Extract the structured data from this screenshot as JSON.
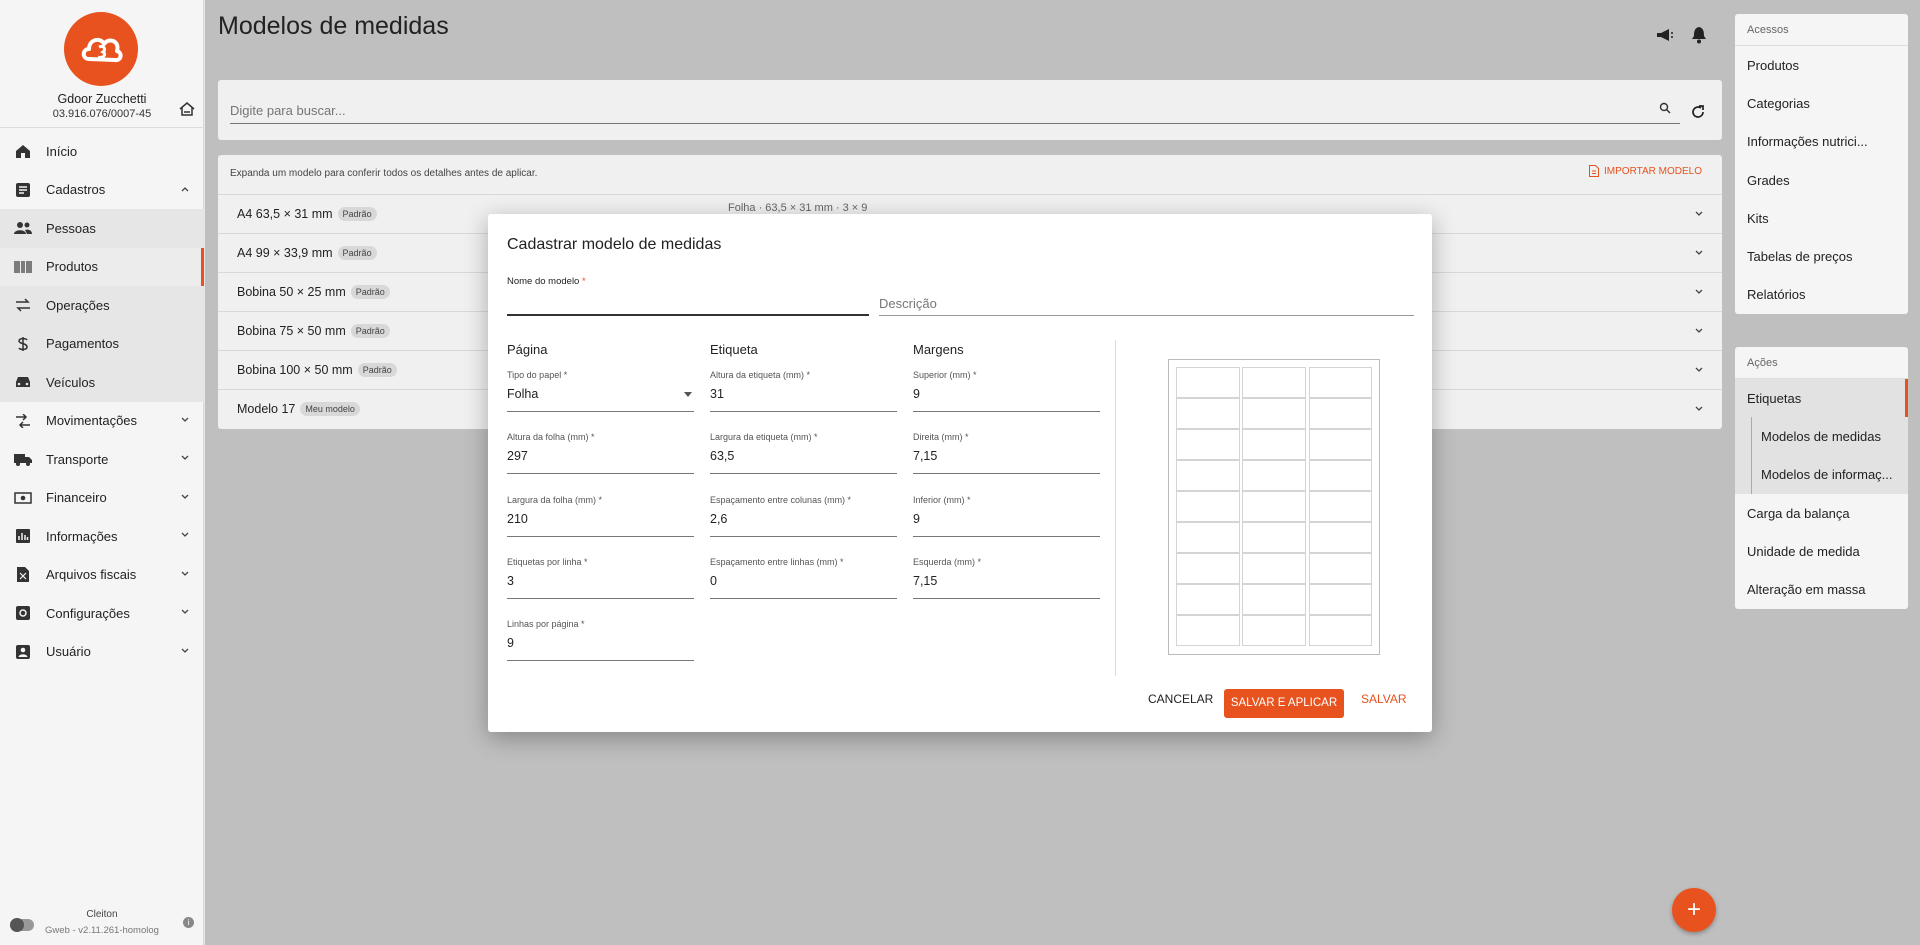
{
  "sidebar": {
    "company_name": "Gdoor Zucchetti",
    "company_cnpj": "03.916.076/0007-45",
    "items": [
      {
        "label": "Início",
        "icon": "home-icon"
      },
      {
        "label": "Cadastros",
        "icon": "list-icon",
        "expanded": true
      },
      {
        "label": "Pessoas",
        "icon": "people-icon"
      },
      {
        "label": "Produtos",
        "icon": "barcode-icon",
        "active": true
      },
      {
        "label": "Operações",
        "icon": "swap-icon"
      },
      {
        "label": "Pagamentos",
        "icon": "dollar-icon"
      },
      {
        "label": "Veículos",
        "icon": "car-icon"
      },
      {
        "label": "Movimentações",
        "icon": "arrows-icon"
      },
      {
        "label": "Transporte",
        "icon": "truck-icon"
      },
      {
        "label": "Financeiro",
        "icon": "money-icon"
      },
      {
        "label": "Informações",
        "icon": "chart-icon"
      },
      {
        "label": "Arquivos fiscais",
        "icon": "file-icon"
      },
      {
        "label": "Configurações",
        "icon": "settings-icon"
      },
      {
        "label": "Usuário",
        "icon": "user-icon"
      }
    ],
    "footer_user": "Cleiton",
    "footer_version": "Gweb - v2.11.261-homolog"
  },
  "page": {
    "title": "Modelos de medidas",
    "search_placeholder": "Digite para buscar...",
    "list_hint": "Expanda um modelo para conferir todos os detalhes antes de aplicar.",
    "import_label": "Importar modelo",
    "rows": [
      {
        "name": "A4 63,5 × 31 mm",
        "badge": "Padrão",
        "detail": "Folha · 63,5 × 31 mm · 3 × 9"
      },
      {
        "name": "A4 99 × 33,9 mm",
        "badge": "Padrão"
      },
      {
        "name": "Bobina 50 × 25 mm",
        "badge": "Padrão"
      },
      {
        "name": "Bobina 75 × 50 mm",
        "badge": "Padrão"
      },
      {
        "name": "Bobina 100 × 50 mm",
        "badge": "Padrão"
      },
      {
        "name": "Modelo 17",
        "badge": "Meu modelo"
      }
    ]
  },
  "right_panel": {
    "acessos_title": "Acessos",
    "acessos": [
      "Produtos",
      "Categorias",
      "Informações nutrici...",
      "Grades",
      "Kits",
      "Tabelas de preços",
      "Relatórios"
    ],
    "acoes_title": "Ações",
    "acoes_selected": "Etiquetas",
    "acoes_sub": [
      "Modelos de medidas",
      "Modelos de informaç..."
    ],
    "acoes_rest": [
      "Carga da balança",
      "Unidade de medida",
      "Alteração em massa"
    ]
  },
  "modal": {
    "title": "Cadastrar modelo de medidas",
    "name_label": "Nome do modelo",
    "name_value": "",
    "desc_placeholder": "Descrição",
    "col_pagina": "Página",
    "col_etiqueta": "Etiqueta",
    "col_margens": "Margens",
    "fields": {
      "tipo_papel": {
        "label": "Tipo do papel *",
        "value": "Folha"
      },
      "altura_folha": {
        "label": "Altura da folha (mm) *",
        "value": "297"
      },
      "largura_folha": {
        "label": "Largura da folha (mm) *",
        "value": "210"
      },
      "etiquetas_linha": {
        "label": "Etiquetas por linha *",
        "value": "3"
      },
      "linhas_pagina": {
        "label": "Linhas por página *",
        "value": "9"
      },
      "altura_etiqueta": {
        "label": "Altura da etiqueta (mm) *",
        "value": "31"
      },
      "largura_etiqueta": {
        "label": "Largura da etiqueta (mm) *",
        "value": "63,5"
      },
      "esp_colunas": {
        "label": "Espaçamento entre colunas (mm) *",
        "value": "2,6"
      },
      "esp_linhas": {
        "label": "Espaçamento entre linhas (mm) *",
        "value": "0"
      },
      "superior": {
        "label": "Superior (mm) *",
        "value": "9"
      },
      "direita": {
        "label": "Direita (mm) *",
        "value": "7,15"
      },
      "inferior": {
        "label": "Inferior (mm) *",
        "value": "9"
      },
      "esquerda": {
        "label": "Esquerda (mm) *",
        "value": "7,15"
      }
    },
    "preview": {
      "columns": 3,
      "rows": 9
    },
    "btn_cancel": "Cancelar",
    "btn_save_apply": "Salvar e aplicar",
    "btn_save": "Salvar"
  },
  "colors": {
    "accent": "#e8521e"
  }
}
